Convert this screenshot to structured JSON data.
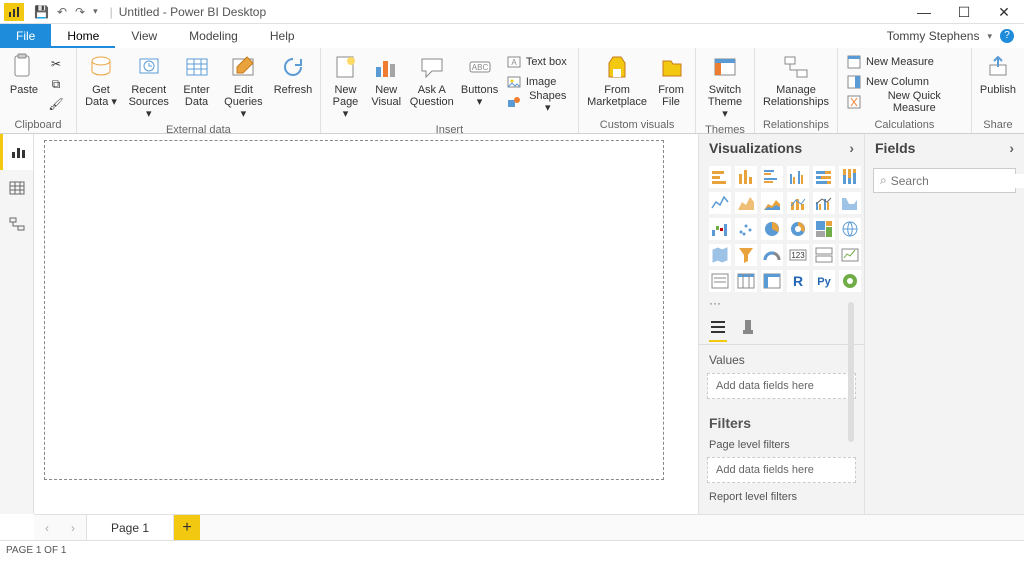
{
  "app": {
    "title": "Untitled - Power BI Desktop",
    "user": "Tommy Stephens"
  },
  "tabs": {
    "file": "File",
    "home": "Home",
    "view": "View",
    "modeling": "Modeling",
    "help": "Help"
  },
  "ribbon": {
    "clipboard": {
      "label": "Clipboard",
      "paste": "Paste"
    },
    "external": {
      "label": "External data",
      "get_data": "Get\nData",
      "recent": "Recent\nSources",
      "enter": "Enter\nData",
      "edit": "Edit\nQueries",
      "refresh": "Refresh"
    },
    "insert": {
      "label": "Insert",
      "new_page": "New\nPage",
      "new_visual": "New\nVisual",
      "ask": "Ask A\nQuestion",
      "buttons": "Buttons",
      "textbox": "Text box",
      "image": "Image",
      "shapes": "Shapes"
    },
    "custom": {
      "label": "Custom visuals",
      "marketplace": "From\nMarketplace",
      "file": "From\nFile"
    },
    "themes": {
      "label": "Themes",
      "switch": "Switch\nTheme"
    },
    "relationships": {
      "label": "Relationships",
      "manage": "Manage\nRelationships"
    },
    "calculations": {
      "label": "Calculations",
      "measure": "New Measure",
      "column": "New Column",
      "quick": "New Quick Measure"
    },
    "share": {
      "label": "Share",
      "publish": "Publish"
    }
  },
  "panes": {
    "viz_title": "Visualizations",
    "fields_title": "Fields",
    "values": "Values",
    "drop_here": "Add data fields here",
    "filters": "Filters",
    "page_filters": "Page level filters",
    "report_filters": "Report level filters",
    "search_placeholder": "Search"
  },
  "pagetabs": {
    "page1": "Page 1"
  },
  "status": "PAGE 1 OF 1"
}
